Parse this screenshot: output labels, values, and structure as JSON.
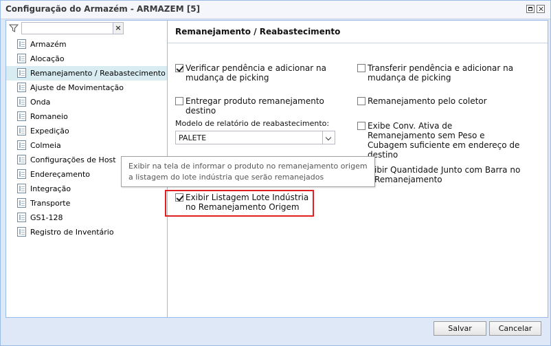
{
  "window": {
    "title": "Configuração do Armazém - ARMAZEM [5]"
  },
  "filter": {
    "value": "",
    "placeholder": "",
    "clear_label": "×"
  },
  "sidebar": {
    "items": [
      {
        "label": "Armazém"
      },
      {
        "label": "Alocação"
      },
      {
        "label": "Remanejamento / Reabastecimento"
      },
      {
        "label": "Ajuste de Movimentação"
      },
      {
        "label": "Onda"
      },
      {
        "label": "Romaneio"
      },
      {
        "label": "Expedição"
      },
      {
        "label": "Colmeia"
      },
      {
        "label": "Configurações de Host"
      },
      {
        "label": "Endereçamento"
      },
      {
        "label": "Integração"
      },
      {
        "label": "Transporte"
      },
      {
        "label": "GS1-128"
      },
      {
        "label": "Registro de Inventário"
      }
    ],
    "selected_index": 2
  },
  "panel": {
    "title": "Remanejamento / Reabastecimento",
    "options": {
      "verificar_pendencia": {
        "label": "Verificar pendência e adicionar na mudança de picking",
        "checked": true
      },
      "transferir_pendencia": {
        "label": "Transferir pendência e adicionar na mudança de picking",
        "checked": false
      },
      "entregar_produto": {
        "label": "Entregar produto remanejamento destino",
        "checked": false
      },
      "remanejamento_coletor": {
        "label": "Remanejamento pelo coletor",
        "checked": false
      },
      "exibe_conv_ativa": {
        "label": "Exibe Conv. Ativa de Remanejamento sem Peso e Cubagem suficiente em endereço de destino",
        "checked": false
      },
      "exibir_quantidade_line1": "ibir Quantidade Junto com Barra no",
      "exibir_quantidade_line2": "Remanejamento",
      "exibir_listagem": {
        "label": "Exibir Listagem Lote Indústria no Remanejamento Origem",
        "checked": true
      }
    },
    "modelo_relatorio": {
      "label": "Modelo de relatório de reabastecimento:",
      "value": "PALETE"
    }
  },
  "tooltip": {
    "text": "Exibir na tela de informar o produto no remanejamento origem a listagem do lote indústria que serão remanejados"
  },
  "footer": {
    "save_label": "Salvar",
    "cancel_label": "Cancelar"
  },
  "colors": {
    "selected_item_bg": "#d9ecf1",
    "highlight_border": "#e02020",
    "border": "#99bbe8"
  }
}
